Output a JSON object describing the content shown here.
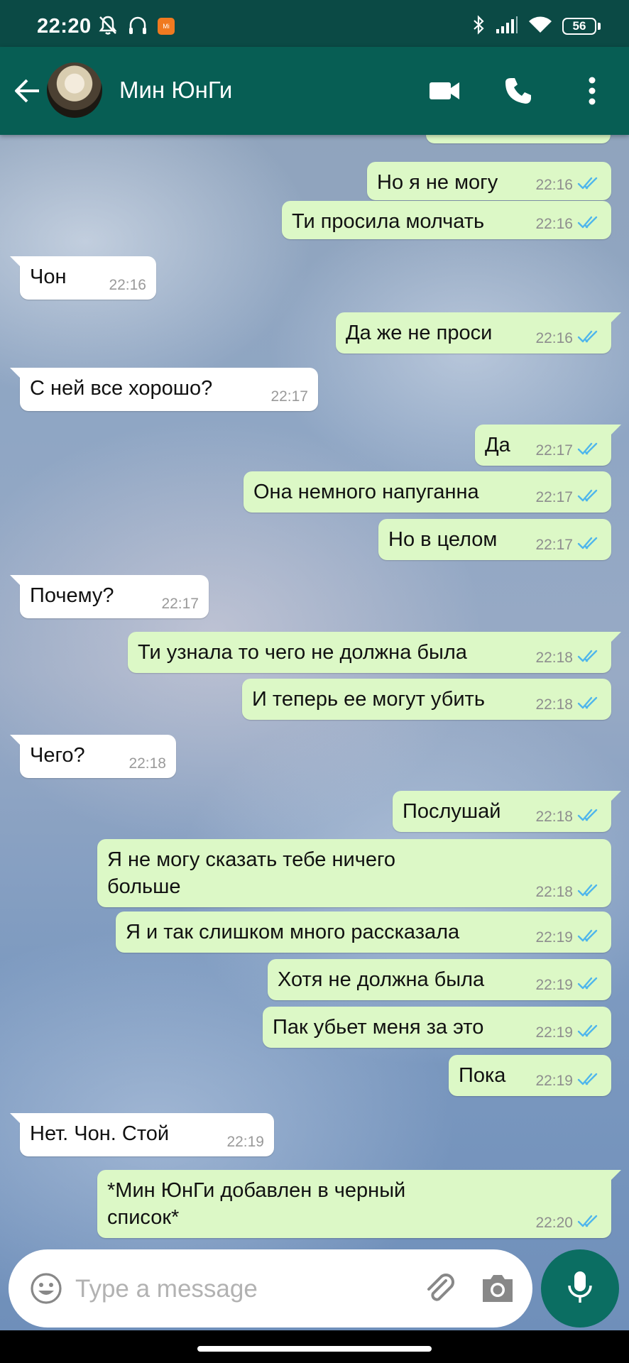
{
  "status_bar": {
    "time": "22:20",
    "battery": "56",
    "icons": [
      "mute-bell-icon",
      "headphones-icon",
      "mi-app-icon",
      "bluetooth-icon",
      "signal-icon",
      "wifi-icon",
      "battery-icon"
    ],
    "mi_badge": "Mi"
  },
  "header": {
    "back_icon": "arrow-left-icon",
    "contact_name": "Мин ЮнГи",
    "actions": [
      "video-call-icon",
      "voice-call-icon",
      "more-vert-icon"
    ]
  },
  "colors": {
    "header": "#075e54",
    "status_bar": "#0b4a45",
    "outgoing_bubble": "#dcf8c6",
    "incoming_bubble": "#ffffff",
    "read_ticks": "#4fb6ec",
    "mic_button": "#0b6e62"
  },
  "messages": [
    {
      "dir": "out",
      "text": "Но я не могу",
      "time": "22:16",
      "read": true
    },
    {
      "dir": "out",
      "text": "Ти просила молчать",
      "time": "22:16",
      "read": true
    },
    {
      "dir": "in",
      "text": "Чон",
      "time": "22:16"
    },
    {
      "dir": "out",
      "text": "Да же не проси",
      "time": "22:16",
      "read": true
    },
    {
      "dir": "in",
      "text": "С ней все хорошо?",
      "time": "22:17"
    },
    {
      "dir": "out",
      "text": "Да",
      "time": "22:17",
      "read": true
    },
    {
      "dir": "out",
      "text": "Она немного напуганна",
      "time": "22:17",
      "read": true
    },
    {
      "dir": "out",
      "text": "Но в целом",
      "time": "22:17",
      "read": true
    },
    {
      "dir": "in",
      "text": "Почему?",
      "time": "22:17"
    },
    {
      "dir": "out",
      "text": "Ти узнала то чего не должна была",
      "time": "22:18",
      "read": true
    },
    {
      "dir": "out",
      "text": "И теперь ее могут убить",
      "time": "22:18",
      "read": true
    },
    {
      "dir": "in",
      "text": "Чего?",
      "time": "22:18"
    },
    {
      "dir": "out",
      "text": "Послушай",
      "time": "22:18",
      "read": true
    },
    {
      "dir": "out",
      "text": "Я не могу сказать тебе ничего\nбольше",
      "time": "22:18",
      "read": true
    },
    {
      "dir": "out",
      "text": "Я и так слишком много рассказала",
      "time": "22:19",
      "read": true
    },
    {
      "dir": "out",
      "text": "Хотя не должна была",
      "time": "22:19",
      "read": true
    },
    {
      "dir": "out",
      "text": "Пак убьет меня за это",
      "time": "22:19",
      "read": true
    },
    {
      "dir": "out",
      "text": "Пока",
      "time": "22:19",
      "read": true
    },
    {
      "dir": "in",
      "text": "Нет. Чон. Стой",
      "time": "22:19"
    },
    {
      "dir": "out",
      "text": "*Мин ЮнГи добавлен в черный\nсписок*",
      "time": "22:20",
      "read": true
    }
  ],
  "composer": {
    "placeholder": "Type a message",
    "icons": [
      "emoji-icon",
      "attach-icon",
      "camera-icon",
      "mic-icon"
    ]
  }
}
